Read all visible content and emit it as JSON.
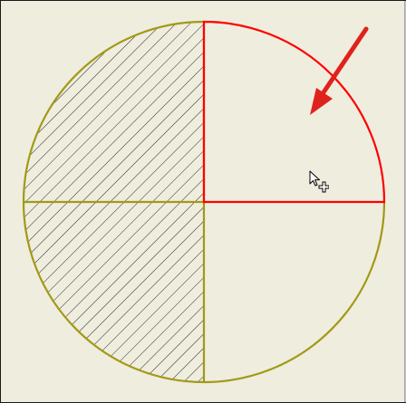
{
  "canvas": {
    "background_color": "#efedde",
    "circle_outline_color": "#a19a17",
    "selected_edge_color": "#ff0000",
    "hatch_color": "#111111",
    "arrow_color": "#e0221c"
  },
  "circle": {
    "quadrants": [
      {
        "id": "upper-left",
        "hatched": true,
        "selected": false
      },
      {
        "id": "upper-right",
        "hatched": false,
        "selected": true
      },
      {
        "id": "lower-left",
        "hatched": true,
        "selected": false
      },
      {
        "id": "lower-right",
        "hatched": false,
        "selected": false
      }
    ]
  },
  "overlay": {
    "annotation_arrow": "red-arrow-icon",
    "pointer": "move-cursor-icon"
  }
}
